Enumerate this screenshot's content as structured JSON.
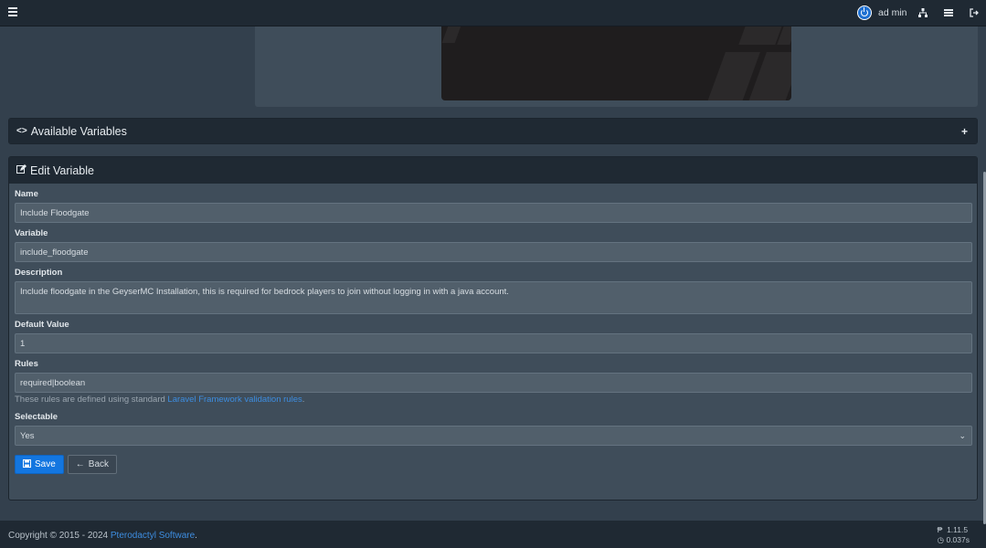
{
  "topbar": {
    "user_name": "ad min",
    "icons": [
      "menu-icon",
      "sitemap-icon",
      "server-list-icon",
      "logout-icon"
    ]
  },
  "sections": {
    "available_variables": "Available Variables",
    "expand_symbol": "+",
    "edit_variable": "Edit Variable"
  },
  "form": {
    "name_label": "Name",
    "name_value": "Include Floodgate",
    "variable_label": "Variable",
    "variable_value": "include_floodgate",
    "description_label": "Description",
    "description_value": "Include floodgate in the GeyserMC Installation, this is required for bedrock players to join without logging in with a java account.",
    "default_label": "Default Value",
    "default_value": "1",
    "rules_label": "Rules",
    "rules_value": "required|boolean",
    "rules_help_prefix": "These rules are defined using standard ",
    "rules_help_link": "Laravel Framework validation rules",
    "rules_help_suffix": ".",
    "selectable_label": "Selectable",
    "selectable_value": "Yes",
    "save_label": "Save",
    "back_label": "Back"
  },
  "footer": {
    "copyright_prefix": "Copyright © 2015 - 2024 ",
    "copyright_link": "Pterodactyl Software",
    "copyright_suffix": ".",
    "version": "1.11.5",
    "time": "0.037s"
  },
  "colors": {
    "topbar_bg": "#1f2933",
    "page_bg": "#33404d",
    "panel_bg": "#3f4d5a",
    "accent": "#1376e0",
    "link": "#3d8de0"
  }
}
